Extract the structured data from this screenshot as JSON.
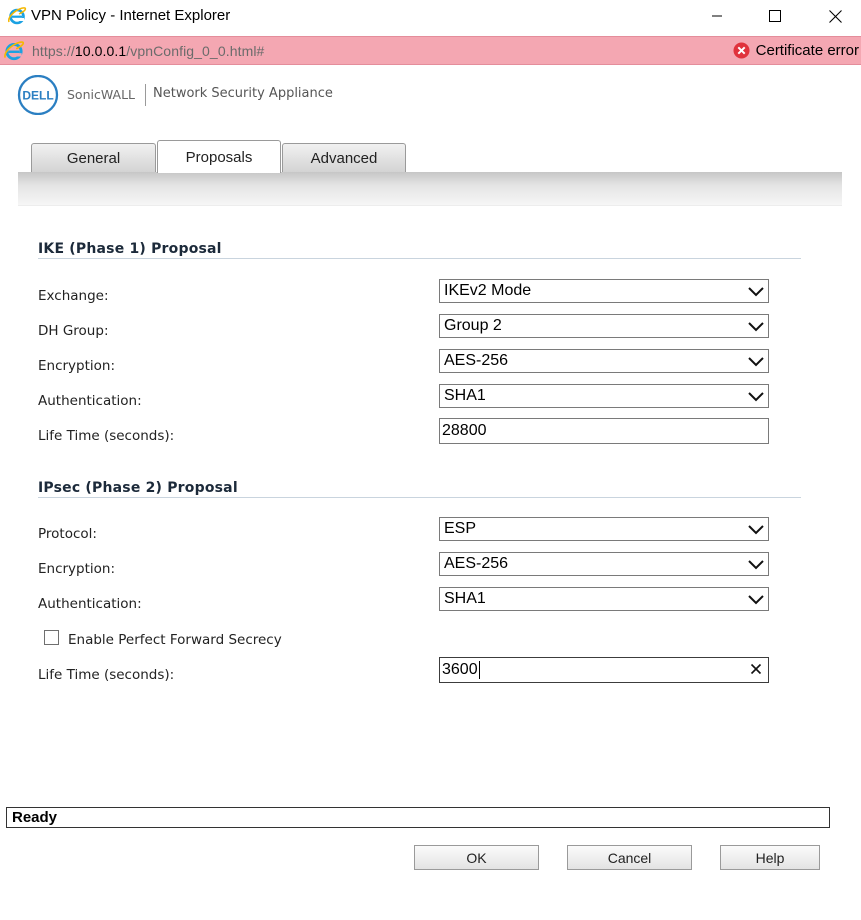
{
  "window": {
    "title": "VPN Policy - Internet Explorer",
    "controls": [
      "minimize",
      "maximize",
      "close"
    ]
  },
  "address_bar": {
    "url_prefix": "https://",
    "url_host": "10.0.0.1",
    "url_path": "/vpnConfig_0_0.html#",
    "certificate_status": "Certificate error",
    "error_color": "#e0323c"
  },
  "header": {
    "logo_text": "DELL",
    "brand": "SonicWALL",
    "product": "Network Security Appliance"
  },
  "tabs": [
    {
      "label": "General",
      "active": false
    },
    {
      "label": "Proposals",
      "active": true
    },
    {
      "label": "Advanced",
      "active": false
    }
  ],
  "ike": {
    "title": "IKE (Phase 1) Proposal",
    "fields": {
      "exchange": {
        "label": "Exchange:",
        "value": "IKEv2 Mode"
      },
      "dh_group": {
        "label": "DH Group:",
        "value": "Group 2"
      },
      "encryption": {
        "label": "Encryption:",
        "value": "AES-256"
      },
      "authentication": {
        "label": "Authentication:",
        "value": "SHA1"
      },
      "lifetime": {
        "label": "Life Time (seconds):",
        "value": "28800"
      }
    }
  },
  "ipsec": {
    "title": "IPsec (Phase 2) Proposal",
    "fields": {
      "protocol": {
        "label": "Protocol:",
        "value": "ESP"
      },
      "encryption": {
        "label": "Encryption:",
        "value": "AES-256"
      },
      "authentication": {
        "label": "Authentication:",
        "value": "SHA1"
      },
      "pfs": {
        "label": "Enable Perfect Forward Secrecy",
        "checked": false
      },
      "lifetime": {
        "label": "Life Time (seconds):",
        "value": "3600"
      }
    }
  },
  "status": {
    "text": "Ready"
  },
  "buttons": {
    "ok": "OK",
    "cancel": "Cancel",
    "help": "Help"
  }
}
